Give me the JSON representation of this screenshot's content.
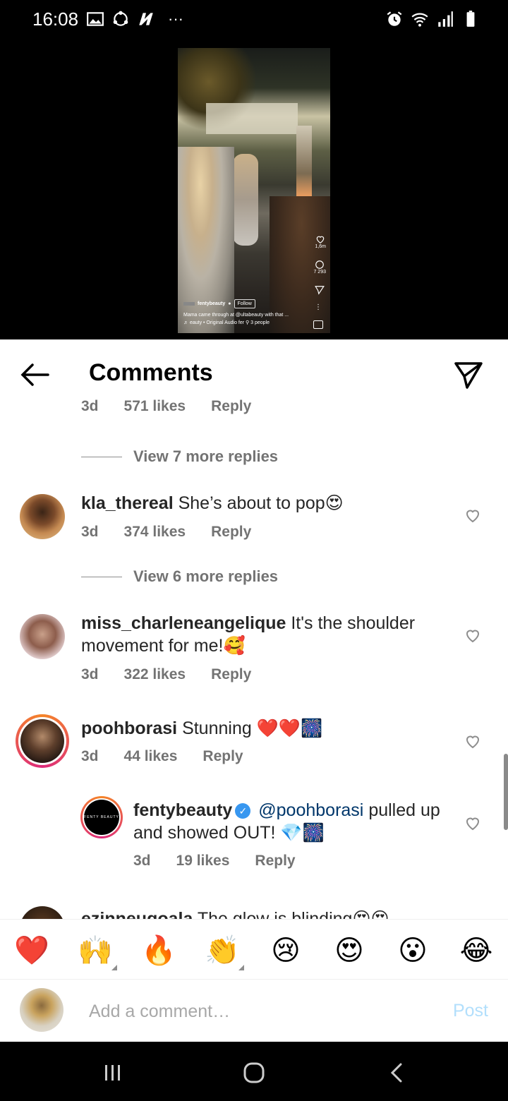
{
  "status": {
    "time": "16:08",
    "dots": "···"
  },
  "video": {
    "likes": "1,6m",
    "comments": "7 293",
    "username": "fentybeauty",
    "follow": "Follow",
    "caption": "Mama came through at @ultabeauty with that ...",
    "audio": "♬ eauty • Original Audio   fer  ⚲ 3 people"
  },
  "header": {
    "title": "Comments"
  },
  "cut_comment": {
    "age": "3d",
    "likes": "571 likes",
    "reply": "Reply"
  },
  "replies_a": {
    "label": "View 7 more replies"
  },
  "replies_b": {
    "label": "View 6 more replies"
  },
  "comments": [
    {
      "username": "kla_thereal",
      "text": "She’s about to pop😍",
      "age": "3d",
      "likes": "374 likes",
      "reply": "Reply"
    },
    {
      "username": "miss_charleneangelique",
      "text": "It's the shoulder movement for me!🥰",
      "age": "3d",
      "likes": "322 likes",
      "reply": "Reply"
    },
    {
      "username": "poohborasi",
      "text": "Stunning ❤️❤️🎆",
      "age": "3d",
      "likes": "44 likes",
      "reply": "Reply"
    },
    {
      "username": "fentybeauty",
      "mention": "@poohborasi",
      "text": "pulled up and showed OUT! 💎🎆",
      "age": "3d",
      "likes": "19 likes",
      "reply": "Reply"
    },
    {
      "username": "ezinneugoala",
      "text": "The glow is blinding😍😍"
    }
  ],
  "emoji_bar": [
    "❤️",
    "🙌",
    "🔥",
    "👏",
    "😢",
    "😍",
    "😮",
    "😂"
  ],
  "input": {
    "placeholder": "Add a comment…",
    "post": "Post"
  },
  "colors": {
    "accent_blue": "#3897f0",
    "post_disabled": "#b2dffc",
    "meta_gray": "#737373"
  }
}
